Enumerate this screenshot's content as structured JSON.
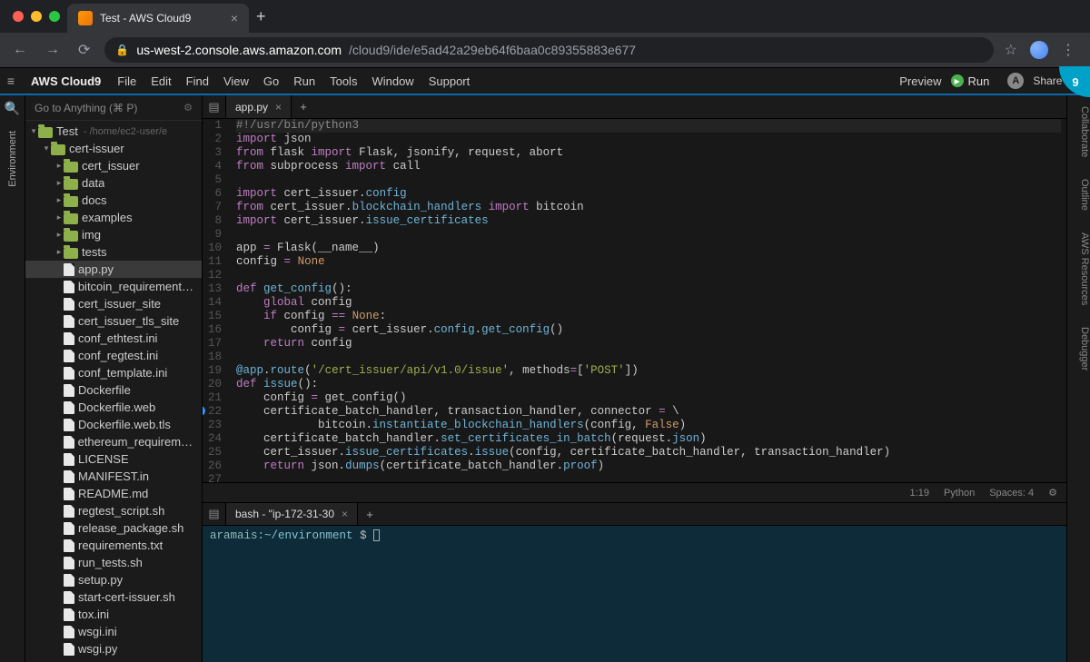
{
  "browser": {
    "tab_title": "Test - AWS Cloud9",
    "url_host": "us-west-2.console.aws.amazon.com",
    "url_path": "/cloud9/ide/e5ad42a29eb64f6baa0c89355883e677"
  },
  "menubar": {
    "logo": "AWS Cloud9",
    "items": [
      "File",
      "Edit",
      "Find",
      "View",
      "Go",
      "Run",
      "Tools",
      "Window",
      "Support"
    ],
    "preview": "Preview",
    "run": "Run",
    "share": "Share",
    "avatar": "A"
  },
  "left_rail": {
    "label": "Environment"
  },
  "right_rail": {
    "tabs": [
      "Collaborate",
      "Outline",
      "AWS Resources",
      "Debugger"
    ]
  },
  "sidebar": {
    "goto": "Go to Anything (⌘ P)",
    "root": {
      "name": "Test",
      "path": "- /home/ec2-user/e"
    },
    "folders": [
      "cert-issuer",
      "cert_issuer",
      "data",
      "docs",
      "examples",
      "img",
      "tests"
    ],
    "files": [
      "app.py",
      "bitcoin_requirements.tx",
      "cert_issuer_site",
      "cert_issuer_tls_site",
      "conf_ethtest.ini",
      "conf_regtest.ini",
      "conf_template.ini",
      "Dockerfile",
      "Dockerfile.web",
      "Dockerfile.web.tls",
      "ethereum_requirements",
      "LICENSE",
      "MANIFEST.in",
      "README.md",
      "regtest_script.sh",
      "release_package.sh",
      "requirements.txt",
      "run_tests.sh",
      "setup.py",
      "start-cert-issuer.sh",
      "tox.ini",
      "wsgi.ini",
      "wsgi.py"
    ]
  },
  "editor": {
    "tab": "app.py",
    "lines": [
      [
        [
          "cm",
          "#!/usr/bin/python3"
        ]
      ],
      [
        [
          "kw",
          "import"
        ],
        [
          "",
          " json"
        ]
      ],
      [
        [
          "kw",
          "from"
        ],
        [
          "",
          " flask "
        ],
        [
          "kw",
          "import"
        ],
        [
          "",
          " Flask, jsonify, request, abort"
        ]
      ],
      [
        [
          "kw",
          "from"
        ],
        [
          "",
          " subprocess "
        ],
        [
          "kw",
          "import"
        ],
        [
          "",
          " call"
        ]
      ],
      [],
      [
        [
          "kw",
          "import"
        ],
        [
          "",
          " cert_issuer."
        ],
        [
          "at",
          "config"
        ]
      ],
      [
        [
          "kw",
          "from"
        ],
        [
          "",
          " cert_issuer."
        ],
        [
          "at",
          "blockchain_handlers"
        ],
        [
          "",
          " "
        ],
        [
          "kw",
          "import"
        ],
        [
          "",
          " bitcoin"
        ]
      ],
      [
        [
          "kw",
          "import"
        ],
        [
          "",
          " cert_issuer."
        ],
        [
          "at",
          "issue_certificates"
        ]
      ],
      [],
      [
        [
          "",
          "app "
        ],
        [
          "op",
          "="
        ],
        [
          "",
          " Flask(__name__)"
        ]
      ],
      [
        [
          "",
          "config "
        ],
        [
          "op",
          "="
        ],
        [
          "",
          " "
        ],
        [
          "bu",
          "None"
        ]
      ],
      [],
      [
        [
          "kw",
          "def"
        ],
        [
          "",
          " "
        ],
        [
          "fn",
          "get_config"
        ],
        [
          "",
          "():"
        ]
      ],
      [
        [
          "",
          "    "
        ],
        [
          "kw",
          "global"
        ],
        [
          "",
          " config"
        ]
      ],
      [
        [
          "",
          "    "
        ],
        [
          "kw",
          "if"
        ],
        [
          "",
          " config "
        ],
        [
          "op",
          "=="
        ],
        [
          "",
          " "
        ],
        [
          "bu",
          "None"
        ],
        [
          "",
          ":"
        ]
      ],
      [
        [
          "",
          "        config "
        ],
        [
          "op",
          "="
        ],
        [
          "",
          " cert_issuer."
        ],
        [
          "at",
          "config"
        ],
        [
          "",
          "."
        ],
        [
          "at",
          "get_config"
        ],
        [
          "",
          "()"
        ]
      ],
      [
        [
          "",
          "    "
        ],
        [
          "kw",
          "return"
        ],
        [
          "",
          " config"
        ]
      ],
      [],
      [
        [
          "at",
          "@app"
        ],
        [
          "",
          "."
        ],
        [
          "at",
          "route"
        ],
        [
          "",
          "("
        ],
        [
          "str",
          "'/cert_issuer/api/v1.0/issue'"
        ],
        [
          "",
          ", methods"
        ],
        [
          "op",
          "="
        ],
        [
          "",
          "["
        ],
        [
          "str",
          "'POST'"
        ],
        [
          "",
          "])"
        ]
      ],
      [
        [
          "kw",
          "def"
        ],
        [
          "",
          " "
        ],
        [
          "fn",
          "issue"
        ],
        [
          "",
          "():"
        ]
      ],
      [
        [
          "",
          "    config "
        ],
        [
          "op",
          "="
        ],
        [
          "",
          " get_config()"
        ]
      ],
      [
        [
          "",
          "    certificate_batch_handler, transaction_handler, connector "
        ],
        [
          "op",
          "="
        ],
        [
          "",
          " \\"
        ]
      ],
      [
        [
          "",
          "            bitcoin."
        ],
        [
          "at",
          "instantiate_blockchain_handlers"
        ],
        [
          "",
          "(config, "
        ],
        [
          "bu",
          "False"
        ],
        [
          "",
          ")"
        ]
      ],
      [
        [
          "",
          "    certificate_batch_handler."
        ],
        [
          "at",
          "set_certificates_in_batch"
        ],
        [
          "",
          "(request."
        ],
        [
          "at",
          "json"
        ],
        [
          "",
          ")"
        ]
      ],
      [
        [
          "",
          "    cert_issuer."
        ],
        [
          "at",
          "issue_certificates"
        ],
        [
          "",
          "."
        ],
        [
          "at",
          "issue"
        ],
        [
          "",
          "(config, certificate_batch_handler, transaction_handler)"
        ]
      ],
      [
        [
          "",
          "    "
        ],
        [
          "kw",
          "return"
        ],
        [
          "",
          " json."
        ],
        [
          "at",
          "dumps"
        ],
        [
          "",
          "(certificate_batch_handler."
        ],
        [
          "at",
          "proof"
        ],
        [
          "",
          ")"
        ]
      ],
      []
    ],
    "info_line": 22
  },
  "status": {
    "pos": "1:19",
    "lang": "Python",
    "spaces": "Spaces: 4"
  },
  "terminal": {
    "tab": "bash - \"ip-172-31-30",
    "user": "aramais",
    "path": "~/environment",
    "prompt": "$"
  }
}
